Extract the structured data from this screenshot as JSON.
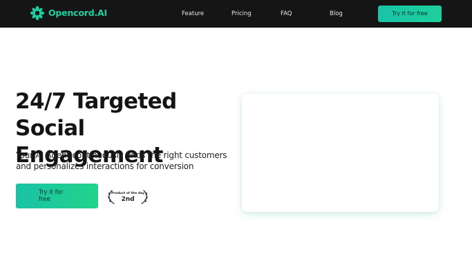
{
  "brand": {
    "name": "Opencord.AI",
    "icon": "opencord-logo-icon",
    "accent_color": "#1fd1a0"
  },
  "nav": {
    "links": [
      "Feature",
      "Pricing",
      "FAQ",
      "Blog"
    ],
    "cta_label": "Try it for free",
    "background_color": "#151515"
  },
  "hero": {
    "title": "24/7 Targeted Social Engagement",
    "subtitle": "Your AI Agent continuously finds the right customers and personalizes interactions for conversion",
    "cta_label": "Try it for free"
  },
  "badge": {
    "label": "Product of the day",
    "rank": "2nd",
    "icon": "laurel-wreath-icon"
  },
  "media": {
    "icon": "empty-preview-card"
  }
}
